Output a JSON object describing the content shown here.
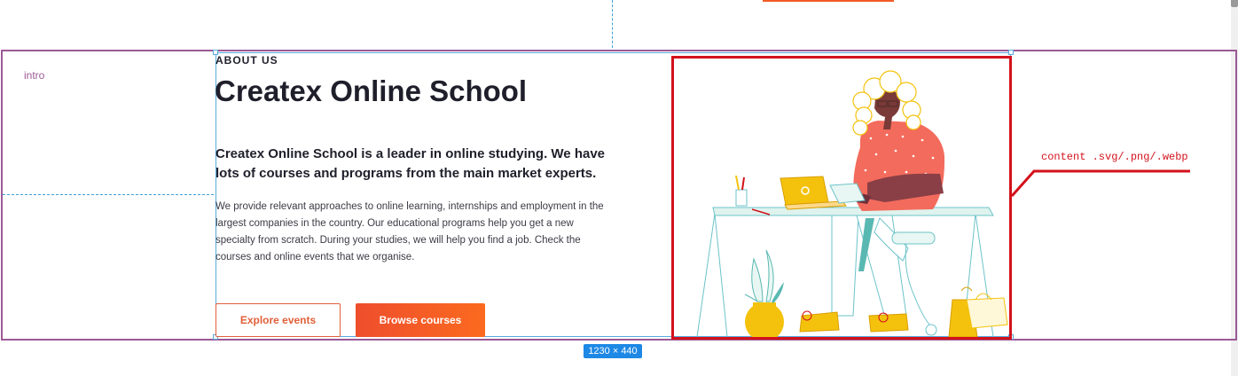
{
  "intro": {
    "label": "intro"
  },
  "selection": {
    "dimensions": "1230 × 440"
  },
  "about": {
    "eyebrow": "ABOUT US",
    "title": "Createx Online School",
    "lead": "Createx Online School is a leader in online studying. We have lots of courses and programs from the main market experts.",
    "body": "We provide relevant approaches to online learning, internships and employment in the largest companies in the country. Our educational programs help you get a new specialty from scratch. During your studies, we will help you find a job. Check the courses and online events that we organise."
  },
  "buttons": {
    "explore_label": "Explore events",
    "browse_label": "Browse courses"
  },
  "illustration": {
    "annotation": "content .svg/.png/.webp"
  },
  "colors": {
    "accent": "#ef4e2d",
    "frame_purple": "#9b5a96",
    "annotation_red": "#d3111b",
    "selection_blue": "#5aa9dc"
  }
}
